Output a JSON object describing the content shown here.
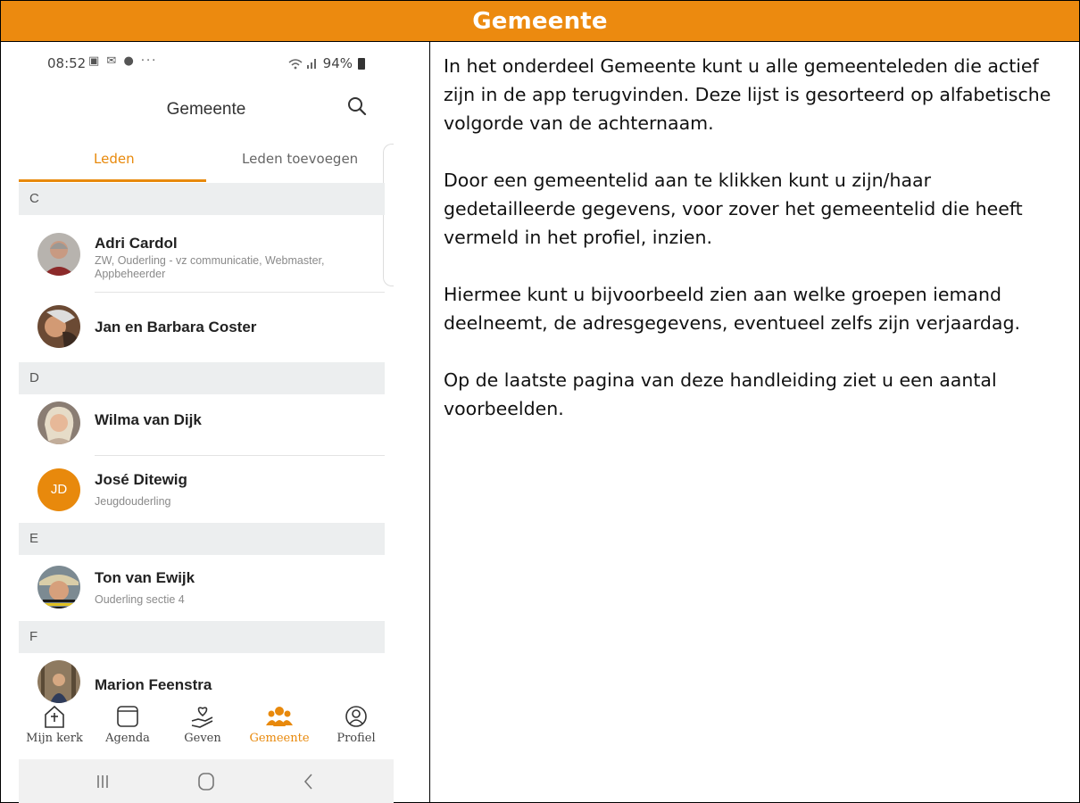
{
  "header": {
    "title": "Gemeente"
  },
  "status_bar": {
    "time": "08:52",
    "left_icons": "▣ ✉ ● ···",
    "right_text": "94%"
  },
  "app": {
    "title": "Gemeente"
  },
  "tabs": [
    {
      "label": "Leden"
    },
    {
      "label": "Leden toevoegen"
    }
  ],
  "sections": [
    {
      "letter": "C"
    },
    {
      "letter": "D"
    },
    {
      "letter": "E"
    },
    {
      "letter": "F"
    }
  ],
  "members": [
    {
      "name": "Adri Cardol",
      "role": "ZW, Ouderling - vz communicatie, Webmaster, Appbeheerder"
    },
    {
      "name": "Jan en Barbara Coster",
      "role": ""
    },
    {
      "name": "Wilma van Dijk",
      "role": ""
    },
    {
      "name": "José Ditewig",
      "role": "Jeugdouderling",
      "initials": "JD"
    },
    {
      "name": "Ton van Ewijk",
      "role": "Ouderling sectie 4"
    },
    {
      "name": "Marion Feenstra",
      "role": ""
    }
  ],
  "bottom_nav": [
    {
      "label": "Mijn kerk",
      "icon": "church-icon"
    },
    {
      "label": "Agenda",
      "icon": "calendar-icon"
    },
    {
      "label": "Geven",
      "icon": "give-icon"
    },
    {
      "label": "Gemeente",
      "icon": "people-icon"
    },
    {
      "label": "Profiel",
      "icon": "profile-icon"
    }
  ],
  "colors": {
    "accent": "#e8890c",
    "header_bg": "#ec8a0f",
    "section_bg": "#eceeef"
  },
  "paragraphs": [
    "In het onderdeel Gemeente kunt u alle gemeenteleden die actief zijn in de app terugvinden. Deze lijst is gesorteerd op alfabetische volgorde van de achternaam.",
    "Door een gemeentelid aan te klikken kunt u zijn/haar gedetailleerde gegevens, voor zover het gemeentelid die heeft vermeld in het profiel, inzien.",
    "Hiermee kunt u bijvoorbeeld zien aan welke groepen iemand deelneemt, de adresgegevens, eventueel zelfs zijn verjaardag.",
    "Op de laatste pagina van deze handleiding ziet u een aantal voorbeelden."
  ]
}
